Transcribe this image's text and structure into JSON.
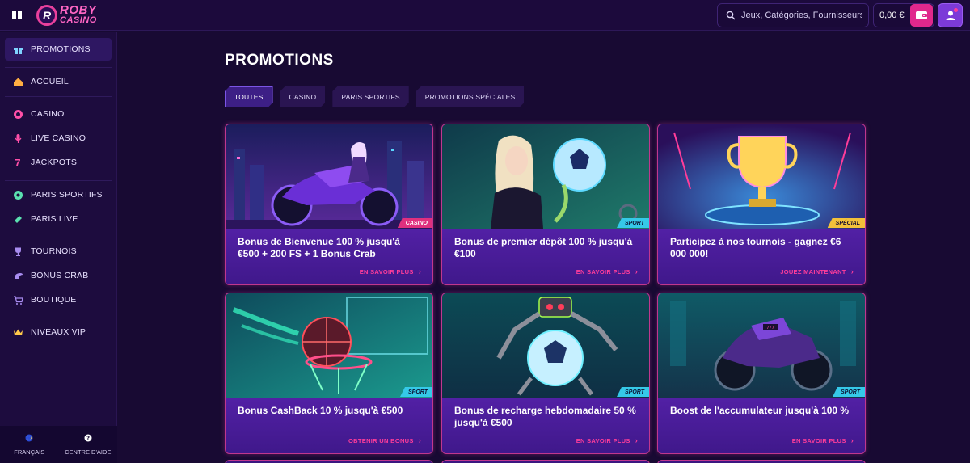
{
  "header": {
    "logo_line1": "ROBY",
    "logo_line2": "CASINO",
    "search_placeholder": "Jeux, Catégories, Fournisseurs",
    "balance": "0,00 €"
  },
  "sidebar": {
    "items": [
      {
        "label": "PROMOTIONS",
        "icon": "gift-icon"
      },
      {
        "label": "ACCUEIL",
        "icon": "home-icon"
      },
      {
        "label": "CASINO",
        "icon": "chip-icon"
      },
      {
        "label": "LIVE CASINO",
        "icon": "microphone-icon"
      },
      {
        "label": "JACKPOTS",
        "icon": "seven-icon"
      },
      {
        "label": "PARIS SPORTIFS",
        "icon": "soccer-ball-icon"
      },
      {
        "label": "PARIS LIVE",
        "icon": "ticket-icon"
      },
      {
        "label": "TOURNOIS",
        "icon": "trophy-icon"
      },
      {
        "label": "BONUS CRAB",
        "icon": "crab-icon"
      },
      {
        "label": "BOUTIQUE",
        "icon": "cart-icon"
      },
      {
        "label": "NIVEAUX VIP",
        "icon": "crown-icon"
      }
    ],
    "language": "FRANÇAIS",
    "help": "CENTRE D'AIDE"
  },
  "main": {
    "title": "PROMOTIONS",
    "tabs": [
      {
        "label": "TOUTES",
        "active": true
      },
      {
        "label": "CASINO",
        "active": false
      },
      {
        "label": "PARIS SPORTIFS",
        "active": false
      },
      {
        "label": "PROMOTIONS SPÉCIALES",
        "active": false
      }
    ],
    "cards": [
      {
        "title": "Bonus de Bienvenue 100 % jusqu'à €500 + 200 FS + 1 Bonus Crab",
        "cta": "EN SAVOIR PLUS",
        "badge": "CASINO"
      },
      {
        "title": "Bonus de premier dépôt 100 % jusqu'à €100",
        "cta": "EN SAVOIR PLUS",
        "badge": "SPORT"
      },
      {
        "title": "Participez à nos tournois - gagnez €6 000 000!",
        "cta": "JOUEZ MAINTENANT",
        "badge": "SPÉCIAL"
      },
      {
        "title": "Bonus CashBack 10 % jusqu'à €500",
        "cta": "OBTENIR UN BONUS",
        "badge": "SPORT"
      },
      {
        "title": "Bonus de recharge hebdomadaire 50 % jusqu'à €500",
        "cta": "EN SAVOIR PLUS",
        "badge": "SPORT"
      },
      {
        "title": "Boost de l'accumulateur jusqu'à 100 %",
        "cta": "EN SAVOIR PLUS",
        "badge": "SPORT"
      }
    ]
  },
  "colors": {
    "accent_pink": "#ff3d9a",
    "card_border": "#c0378e",
    "card_body": "#4a1d93",
    "badge_sport": "#35c9e8",
    "badge_casino": "#e0307e",
    "badge_special": "#f2c13a"
  }
}
